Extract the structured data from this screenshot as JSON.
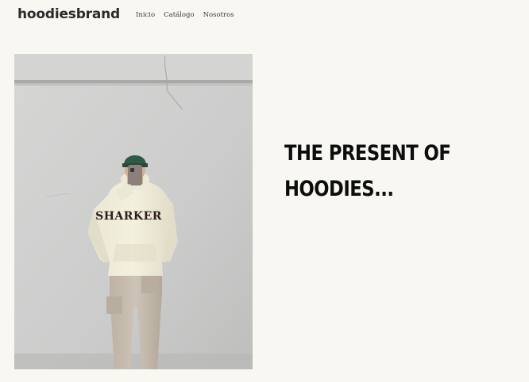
{
  "header": {
    "brand": "hoodiesbrand",
    "nav": [
      {
        "label": "Inicio"
      },
      {
        "label": "Catálogo"
      },
      {
        "label": "Nosotros"
      }
    ]
  },
  "hero": {
    "headline_line1": "THE PRESENT OF",
    "headline_line2": "HOODIES...",
    "hoodie_print": "SHARKER",
    "colors": {
      "background": "#f8f7f1",
      "wall": "#cfd0ce",
      "hoodie": "#efecd8",
      "cap": "#2f5a45",
      "pants": "#c9beb0"
    }
  }
}
